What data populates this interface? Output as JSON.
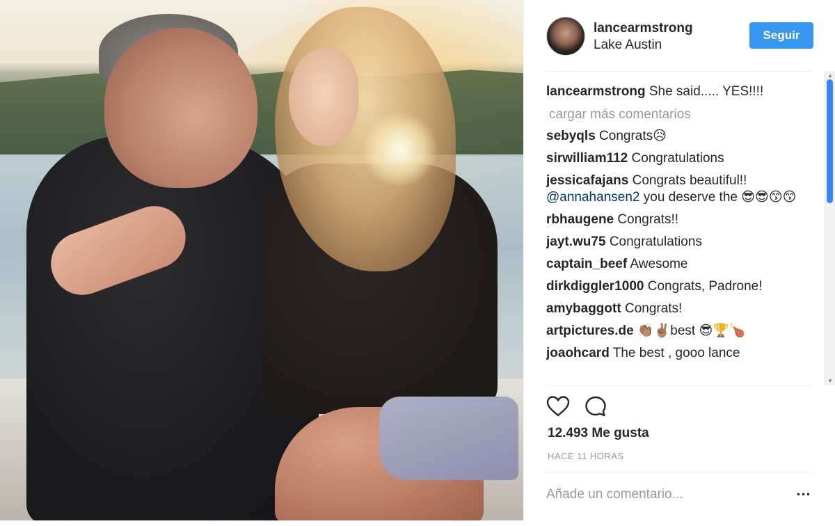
{
  "post": {
    "username": "lancearmstrong",
    "location": "Lake Austin",
    "follow_label": "Seguir"
  },
  "caption": {
    "user": "lancearmstrong",
    "text": " She said..... YES!!!!"
  },
  "load_more": "cargar más comentarios",
  "comments": [
    {
      "user": "sebyqls",
      "text": " Congrats😥"
    },
    {
      "user": "sirwilliam112",
      "text": " Congratulations"
    },
    {
      "user": "jessicafajans",
      "text": " Congrats beautiful!!",
      "mention": "@annahansen2",
      "tail": " you deserve the 😎😎😙😙"
    },
    {
      "user": "rbhaugene",
      "text": " Congrats!!"
    },
    {
      "user": "jayt.wu75",
      "text": " Congratulations"
    },
    {
      "user": "captain_beef",
      "text": " Awesome"
    },
    {
      "user": "dirkdiggler1000",
      "text": " Congrats, Padrone!"
    },
    {
      "user": "amybaggott",
      "text": " Congrats!"
    },
    {
      "user": "artpictures.de",
      "text": " 👏🏽✌🏽best 😎🏆🍗"
    },
    {
      "user": "joaohcard",
      "text": " The best , gooo lance"
    }
  ],
  "likes": "12.493 Me gusta",
  "time": "HACE 11 HORAS",
  "add_comment_placeholder": "Añade un comentario...",
  "more_label": "...",
  "icons": {
    "heart": "heart-icon",
    "comment": "speech-bubble-icon",
    "more": "ellipsis-icon"
  },
  "colors": {
    "follow_button": "#3897f0",
    "muted_text": "#999999",
    "mention": "#003569"
  }
}
